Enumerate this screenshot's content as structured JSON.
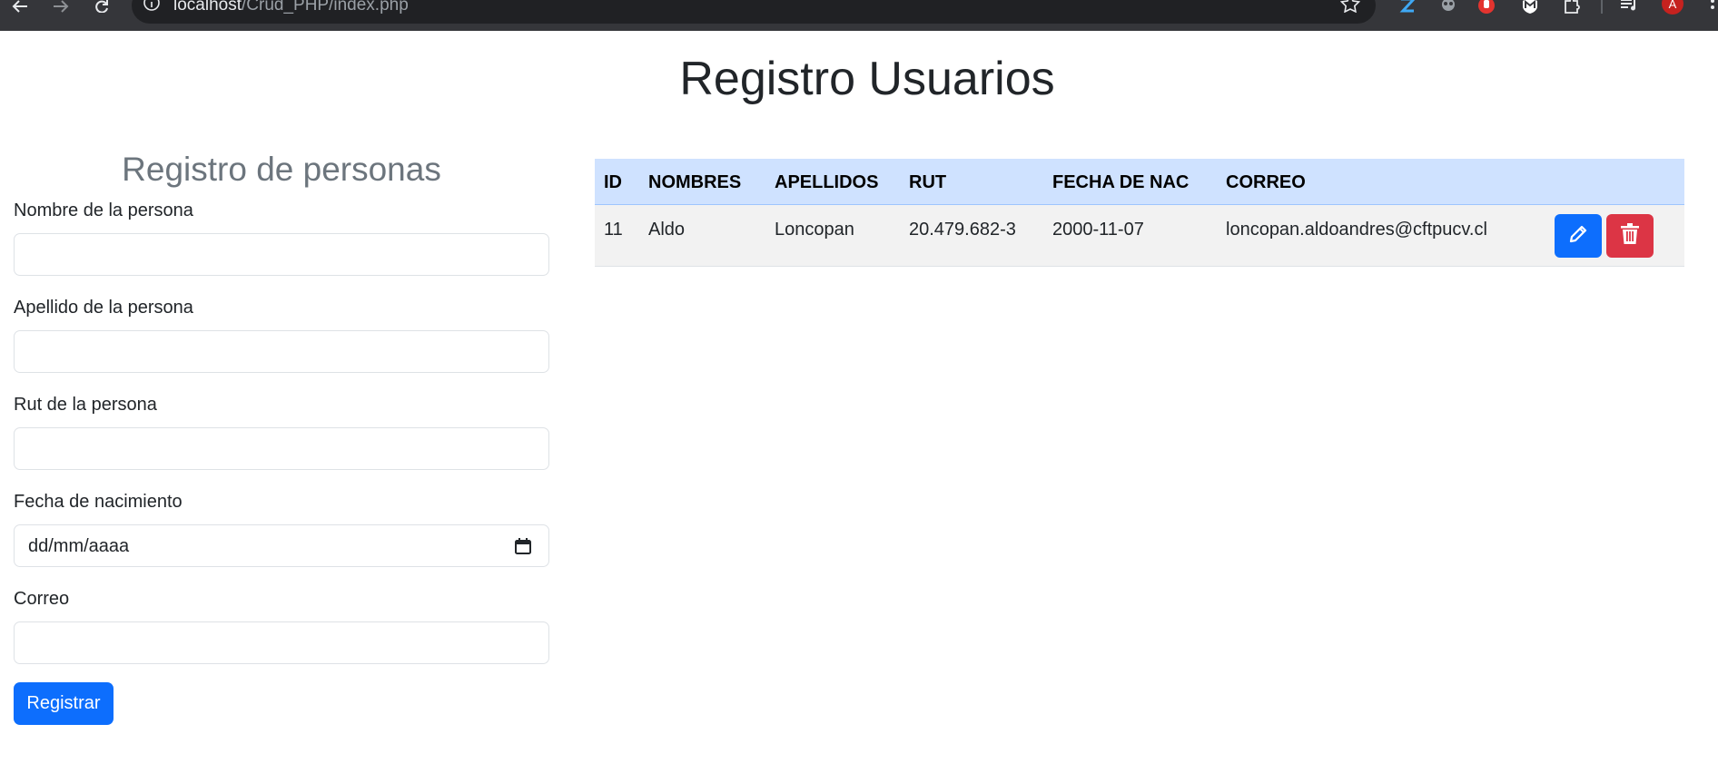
{
  "browser": {
    "url_host": "localhost",
    "url_path": "/Crud_PHP/index.php",
    "avatar_letter": "A",
    "icons": {
      "back": "arrow-left-icon",
      "forward": "arrow-right-icon",
      "reload": "reload-icon",
      "site_info": "info-icon",
      "bookmark": "star-icon",
      "extensions": [
        "zotero-icon",
        "owl-icon",
        "hand-stop-icon",
        "shield-m-icon",
        "puzzle-icon",
        "media-queue-icon"
      ],
      "menu": "kebab-menu-icon"
    }
  },
  "page": {
    "title": "Registro Usuarios"
  },
  "form": {
    "title": "Registro de personas",
    "fields": [
      {
        "label": "Nombre de la persona",
        "value": ""
      },
      {
        "label": "Apellido de la persona",
        "value": ""
      },
      {
        "label": "Rut de la persona",
        "value": ""
      },
      {
        "label": "Fecha de nacimiento",
        "value": "dd/mm/aaaa"
      },
      {
        "label": "Correo",
        "value": ""
      }
    ],
    "submit_label": "Registrar"
  },
  "table": {
    "headers": [
      "ID",
      "NOMBRES",
      "APELLIDOS",
      "RUT",
      "FECHA DE NAC",
      "CORREO"
    ],
    "rows": [
      {
        "id": "11",
        "nombres": "Aldo",
        "apellidos": "Loncopan",
        "rut": "20.479.682-3",
        "fecha": "2000-11-07",
        "correo": "loncopan.aldoandres@cftpucv.cl",
        "actions": [
          "pencil-icon",
          "trash-icon"
        ]
      }
    ]
  },
  "colors": {
    "primary": "#0d6efd",
    "danger": "#dc3545",
    "table_header": "#cfe2ff",
    "row_striped": "#f2f2f2",
    "muted_heading": "#6c757d"
  }
}
